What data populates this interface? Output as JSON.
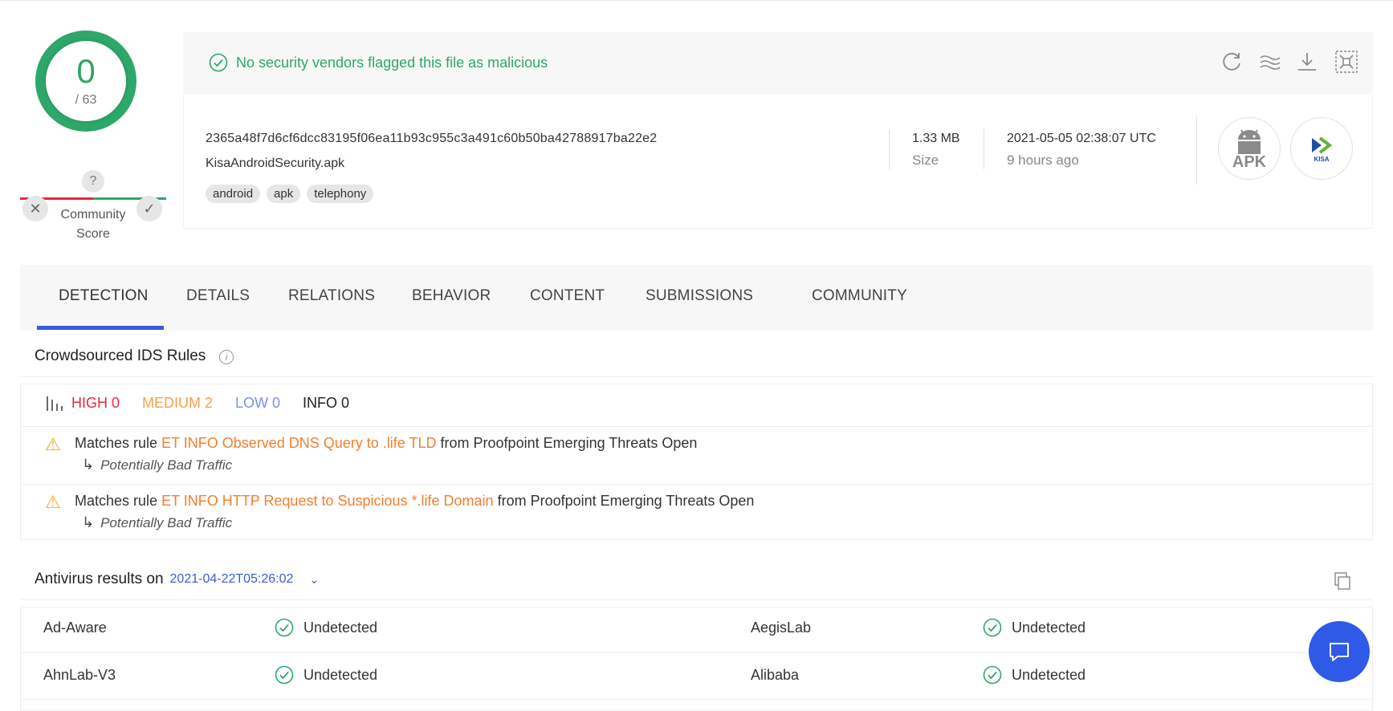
{
  "score": {
    "detections": "0",
    "total": "/ 63"
  },
  "community": {
    "question": "?",
    "label_line1": "Community",
    "label_line2": "Score",
    "downvote": "✕",
    "upvote": "✓"
  },
  "summary": {
    "message": "No security vendors flagged this file as malicious",
    "hash": "2365a48f7d6cf6dcc83195f06ea11b93c955c3a491c60b50ba42788917ba22e2",
    "filename": "KisaAndroidSecurity.apk",
    "tags": [
      "android",
      "apk",
      "telephony"
    ],
    "size_value": "1.33 MB",
    "size_label": "Size",
    "date_value": "2021-05-05 02:38:07 UTC",
    "date_ago": "9 hours ago",
    "filetype_label": "APK",
    "vendor_logo_label": "KISA"
  },
  "toolbar_icons": [
    "reanalyze-icon",
    "similar-icon",
    "download-icon",
    "graph-icon"
  ],
  "tabs": [
    "DETECTION",
    "DETAILS",
    "RELATIONS",
    "BEHAVIOR",
    "CONTENT",
    "SUBMISSIONS",
    "COMMUNITY"
  ],
  "ids": {
    "title": "Crowdsourced IDS Rules",
    "high": "HIGH 0",
    "medium": "MEDIUM 2",
    "low": "LOW 0",
    "info": "INFO 0",
    "rules": [
      {
        "prefix": "Matches rule",
        "name": "ET INFO Observed DNS Query to .life TLD",
        "suffix": "from Proofpoint Emerging Threats Open",
        "category": "Potentially Bad Traffic"
      },
      {
        "prefix": "Matches rule",
        "name": "ET INFO HTTP Request to Suspicious *.life Domain",
        "suffix": "from Proofpoint Emerging Threats Open",
        "category": "Potentially Bad Traffic"
      }
    ]
  },
  "antivirus": {
    "title": "Antivirus results on",
    "date": "2021-04-22T05:26:02",
    "rows": [
      {
        "left_engine": "Ad-Aware",
        "left_result": "Undetected",
        "right_engine": "AegisLab",
        "right_result": "Undetected"
      },
      {
        "left_engine": "AhnLab-V3",
        "left_result": "Undetected",
        "right_engine": "Alibaba",
        "right_result": "Undetected"
      }
    ]
  },
  "colors": {
    "clean": "#2ea76a",
    "high": "#e8273f",
    "medium": "#f5a04a",
    "low": "#7b8ff0",
    "accent": "#3b5bdb",
    "rule_link": "#f37f2d"
  }
}
